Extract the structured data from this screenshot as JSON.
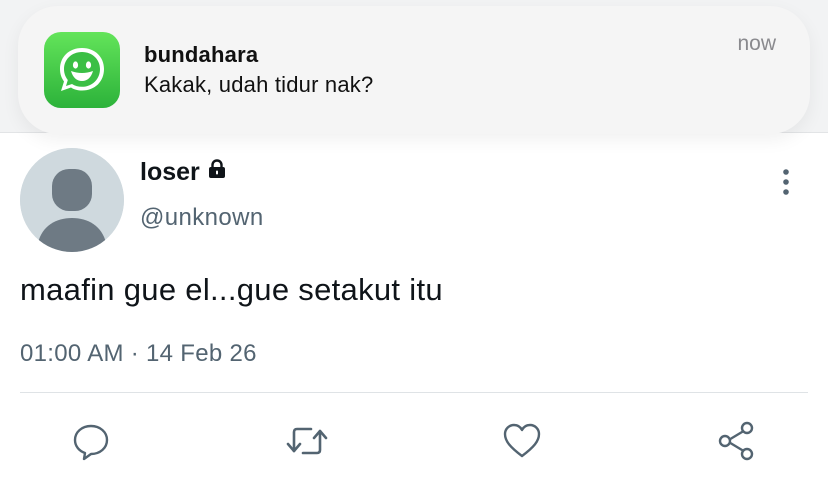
{
  "notification": {
    "app_icon": "messaging-app-smiley-icon",
    "app_color": "#3ec94a",
    "title": "bundahara",
    "message": "Kakak, udah tidur nak?",
    "time": "now"
  },
  "tweet": {
    "display_name": "loser",
    "protected_icon": "lock-icon",
    "username": "@unknown",
    "text": "maafin gue el...gue setakut itu",
    "timestamp": "01:00 AM · 14 Feb 26",
    "more_icon": "vertical-ellipsis-icon"
  },
  "actions": [
    {
      "icon": "reply-icon"
    },
    {
      "icon": "retweet-icon"
    },
    {
      "icon": "like-icon"
    },
    {
      "icon": "share-icon"
    }
  ],
  "colors": {
    "text_primary": "#0f1419",
    "text_secondary": "#536471",
    "icon": "#536471"
  }
}
